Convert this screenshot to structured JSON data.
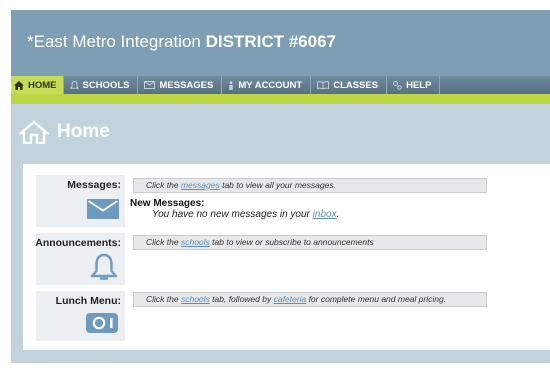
{
  "header": {
    "title_prefix": "*East Metro Integration ",
    "title_strong": "DISTRICT #6067"
  },
  "nav": [
    {
      "label": "HOME",
      "icon": "home-icon",
      "active": true
    },
    {
      "label": "SCHOOLS",
      "icon": "bell-icon"
    },
    {
      "label": "MESSAGES",
      "icon": "envelope-icon"
    },
    {
      "label": "MY ACCOUNT",
      "icon": "person-icon"
    },
    {
      "label": "CLASSES",
      "icon": "book-icon"
    },
    {
      "label": "HELP",
      "icon": "help-icon"
    }
  ],
  "page": {
    "heading": "Home",
    "icon": "home-icon"
  },
  "messages": {
    "label": "Messages:",
    "icon": "envelope-icon",
    "bar_pre": "Click the ",
    "bar_link": "messages",
    "bar_post": " tab to view all your messages.",
    "new_title": "New Messages:",
    "new_body_pre": "You have no new messages in your ",
    "new_body_link": "inbox",
    "new_body_post": "."
  },
  "announcements": {
    "label": "Announcements:",
    "icon": "bell-icon",
    "bar_pre": "Click the ",
    "bar_link": "schools",
    "bar_post": " tab to view or subscribe to announcements"
  },
  "lunch": {
    "label": "Lunch Menu:",
    "icon": "camera-icon",
    "bar_pre": "Click the ",
    "bar_link": "schools",
    "bar_mid": " tab, followed by ",
    "bar_link2": "cafeteria",
    "bar_post": " for complete menu and meal pricing."
  },
  "colors": {
    "header": "#7e9fb3",
    "nav": "#56707f",
    "accent": "#bcd645",
    "panel": "#c3d3dd",
    "icon": "#6d9bbf"
  }
}
